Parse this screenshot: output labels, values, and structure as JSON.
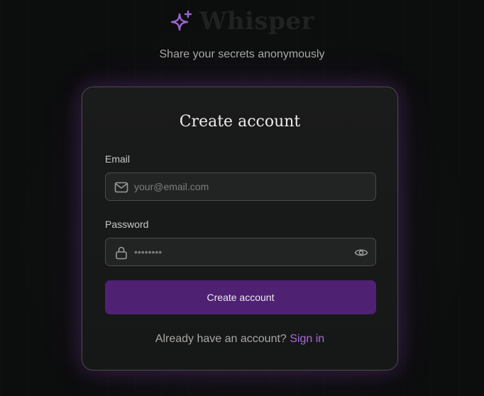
{
  "brand": {
    "name": "Whisper",
    "icon": "sparkles-icon",
    "tagline": "Share your secrets anonymously"
  },
  "form": {
    "title": "Create account",
    "email": {
      "label": "Email",
      "icon": "mail-icon",
      "value": "",
      "placeholder": "your@email.com"
    },
    "password": {
      "label": "Password",
      "icon": "lock-icon",
      "value": "",
      "placeholder": "••••••••",
      "toggle_icon": "eye-icon"
    },
    "submit_label": "Create account",
    "switch_prompt": "Already have an account?",
    "switch_link": "Sign in"
  },
  "colors": {
    "accent": "#a86bd6",
    "button": "#4f2173",
    "background": "#0d0e0e"
  }
}
